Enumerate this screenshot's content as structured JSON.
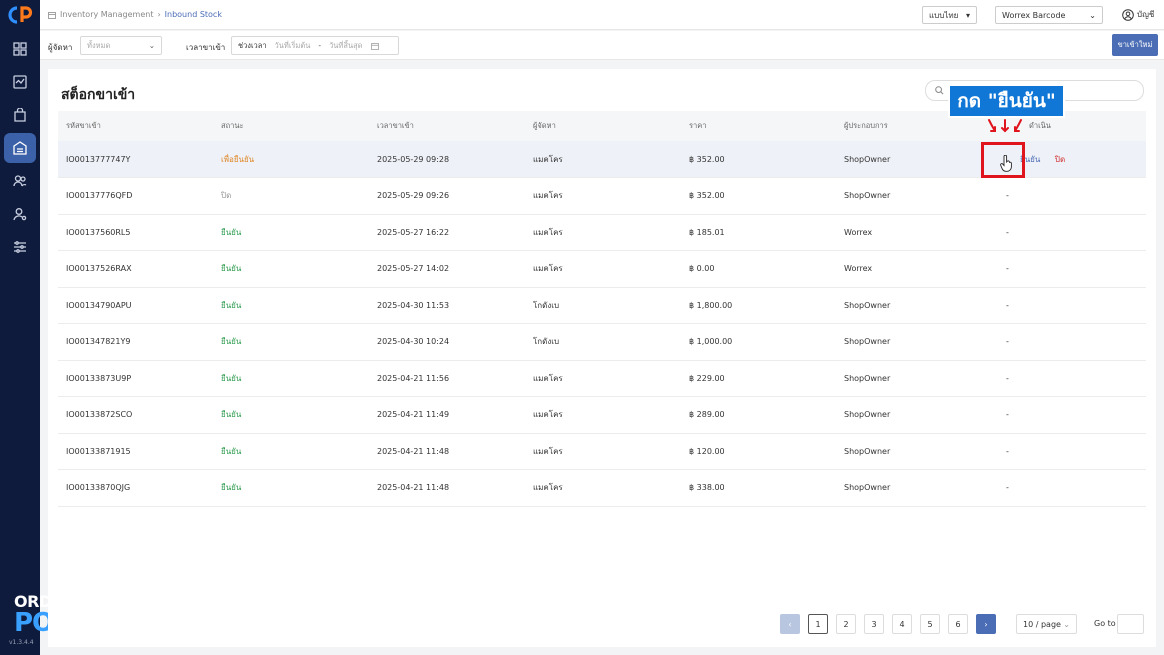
{
  "breadcrumb": {
    "root": "Inventory Management",
    "current": "Inbound Stock"
  },
  "header": {
    "language": "แบบไทย",
    "store": "Worrex Barcode",
    "account": "บัญชี"
  },
  "filters": {
    "supplier_label": "ผู้จัดหา",
    "supplier_placeholder": "ทั้งหมด",
    "date_label": "เวลาขาเข้า",
    "range_label": "ช่วงเวลา",
    "start_placeholder": "วันที่เริ่มต้น",
    "end_placeholder": "วันที่สิ้นสุด",
    "separator": "-",
    "new_button": "ขาเข้าใหม่"
  },
  "page": {
    "title": "สต็อกขาเข้า"
  },
  "table": {
    "columns": [
      "รหัสขาเข้า",
      "สถานะ",
      "เวลาขาเข้า",
      "ผู้จัดหา",
      "ราคา",
      "ผู้ประกอบการ",
      "ดำเนิน"
    ],
    "rows": [
      {
        "id": "IO0013777747Y",
        "status": "เพื่อยืนยัน",
        "time": "2025-05-29 09:28",
        "supplier": "แมคโคร",
        "price": "฿ 352.00",
        "operator": "ShopOwner",
        "action1": "ยืนยัน",
        "action2": "ปิด"
      },
      {
        "id": "IO00137776QFD",
        "status": "ปิด",
        "time": "2025-05-29 09:26",
        "supplier": "แมคโคร",
        "price": "฿ 352.00",
        "operator": "ShopOwner",
        "action": "-"
      },
      {
        "id": "IO00137560RL5",
        "status": "ยืนยัน",
        "time": "2025-05-27 16:22",
        "supplier": "แมคโคร",
        "price": "฿ 185.01",
        "operator": "Worrex",
        "action": "-"
      },
      {
        "id": "IO00137526RAX",
        "status": "ยืนยัน",
        "time": "2025-05-27 14:02",
        "supplier": "แมคโคร",
        "price": "฿ 0.00",
        "operator": "Worrex",
        "action": "-"
      },
      {
        "id": "IO00134790APU",
        "status": "ยืนยัน",
        "time": "2025-04-30 11:53",
        "supplier": "โกดังเบ",
        "price": "฿ 1,800.00",
        "operator": "ShopOwner",
        "action": "-"
      },
      {
        "id": "IO001347821Y9",
        "status": "ยืนยัน",
        "time": "2025-04-30 10:24",
        "supplier": "โกดังเบ",
        "price": "฿ 1,000.00",
        "operator": "ShopOwner",
        "action": "-"
      },
      {
        "id": "IO00133873U9P",
        "status": "ยืนยัน",
        "time": "2025-04-21 11:56",
        "supplier": "แมคโคร",
        "price": "฿ 229.00",
        "operator": "ShopOwner",
        "action": "-"
      },
      {
        "id": "IO00133872SCO",
        "status": "ยืนยัน",
        "time": "2025-04-21 11:49",
        "supplier": "แมคโคร",
        "price": "฿ 289.00",
        "operator": "ShopOwner",
        "action": "-"
      },
      {
        "id": "IO00133871915",
        "status": "ยืนยัน",
        "time": "2025-04-21 11:48",
        "supplier": "แมคโคร",
        "price": "฿ 120.00",
        "operator": "ShopOwner",
        "action": "-"
      },
      {
        "id": "IO00133870QJG",
        "status": "ยืนยัน",
        "time": "2025-04-21 11:48",
        "supplier": "แมคโคร",
        "price": "฿ 338.00",
        "operator": "ShopOwner",
        "action": "-"
      }
    ]
  },
  "annotation": {
    "text": "กด \"ยืนยัน\""
  },
  "pagination": {
    "pages": [
      "1",
      "2",
      "3",
      "4",
      "5",
      "6"
    ],
    "page_size": "10 / page",
    "goto_label": "Go to"
  },
  "brand": {
    "line1": "ORDER",
    "line2": "POS",
    "version": "v1.3.4.4"
  },
  "colors": {
    "sidebar": "#0f1b3d",
    "accent": "#4a6db5",
    "pending": "#e0892a",
    "confirmed": "#2e9b4f",
    "annotation": "#1177d6",
    "highlight_box": "#e0141c"
  }
}
